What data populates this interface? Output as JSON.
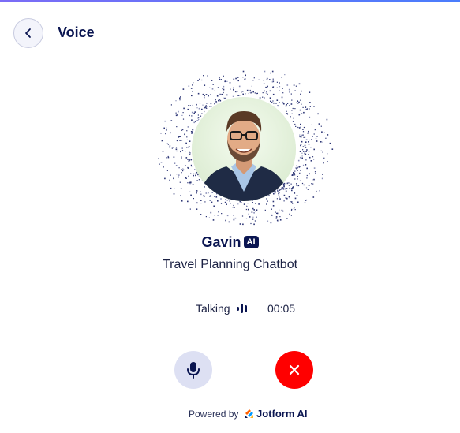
{
  "header": {
    "title": "Voice",
    "back_icon": "chevron-left-icon"
  },
  "agent": {
    "name": "Gavin",
    "badge": "AI",
    "role": "Travel Planning Chatbot"
  },
  "call": {
    "status": "Talking",
    "timer": "00:05"
  },
  "controls": {
    "mic_icon": "microphone-icon",
    "end_icon": "close-icon"
  },
  "footer": {
    "powered_by": "Powered by",
    "brand": "Jotform AI"
  },
  "colors": {
    "primary": "#0a1551",
    "end_call": "#ff0000",
    "mic_bg": "#dde0f3"
  }
}
